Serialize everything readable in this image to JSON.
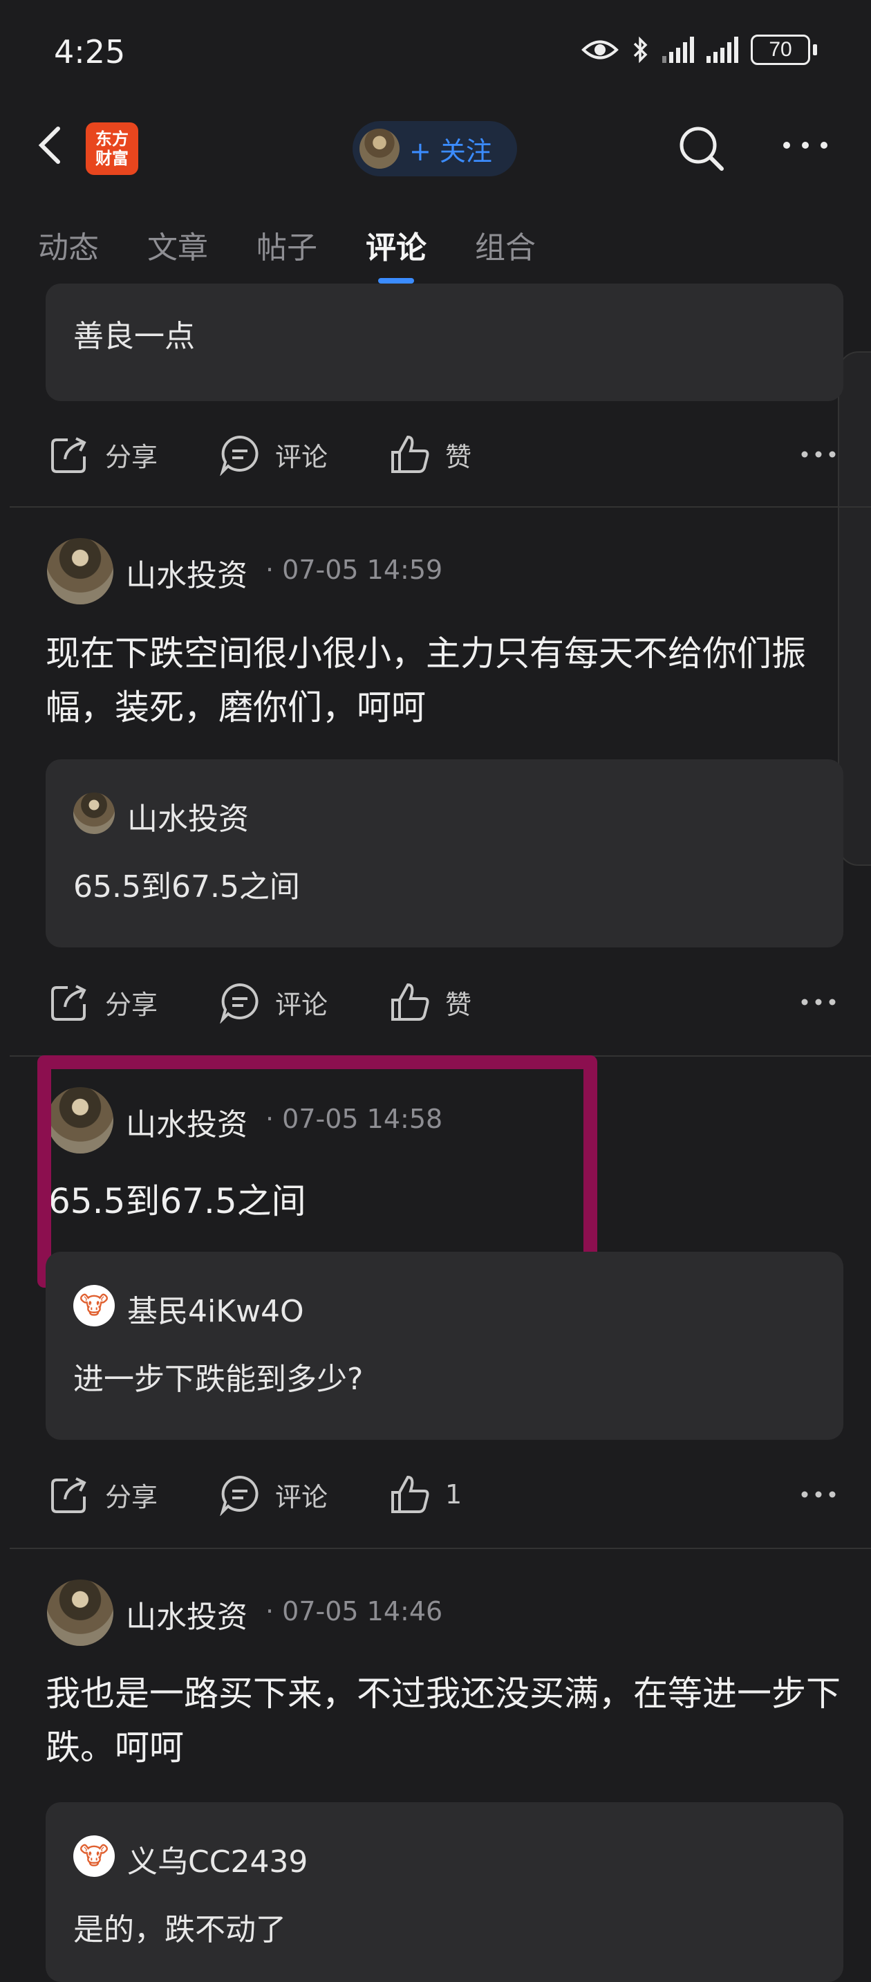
{
  "status_bar": {
    "time": "4:25",
    "battery": "70"
  },
  "header": {
    "logo_line1": "东方",
    "logo_line2": "财富",
    "follow_label": "+ 关注"
  },
  "tabs": [
    {
      "label": "动态"
    },
    {
      "label": "文章"
    },
    {
      "label": "帖子"
    },
    {
      "label": "评论"
    },
    {
      "label": "组合"
    }
  ],
  "actions": {
    "share": "分享",
    "comment": "评论",
    "like": "赞"
  },
  "posts": [
    {
      "quote_text": "善良一点"
    },
    {
      "author": "山水投资",
      "time": "· 07-05 14:59",
      "text": "现在下跌空间很小很小，主力只有每天不给你们振幅，装死，磨你们，呵呵",
      "quote_author": "山水投资",
      "quote_text": "65.5到67.5之间"
    },
    {
      "author": "山水投资",
      "time": "· 07-05 14:58",
      "text": "65.5到67.5之间",
      "quote_author": "基民4iKw4O",
      "quote_text": "进一步下跌能到多少?",
      "like_count": "1"
    },
    {
      "author": "山水投资",
      "time": "· 07-05 14:46",
      "text": "我也是一路买下来，不过我还没买满，在等进一步下跌。呵呵",
      "quote_author": "义乌CC2439",
      "quote_text": "是的，跌不动了"
    }
  ],
  "colors": {
    "accent": "#3b8cff",
    "highlight": "#8c0f4f",
    "logo": "#e8461e"
  }
}
